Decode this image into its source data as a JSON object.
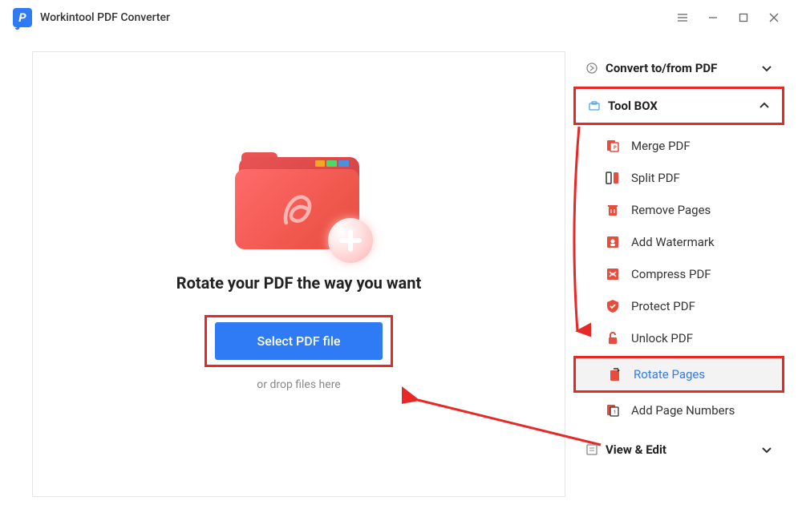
{
  "app": {
    "title": "Workintool PDF Converter"
  },
  "main": {
    "heading": "Rotate your PDF the way you want",
    "select_button": "Select PDF file",
    "drop_hint": "or drop files here"
  },
  "sidebar": {
    "sections": {
      "convert": {
        "label": "Convert to/from PDF"
      },
      "toolbox": {
        "label": "Tool BOX"
      },
      "view_edit": {
        "label": "View & Edit"
      }
    },
    "tools": [
      {
        "label": "Merge PDF"
      },
      {
        "label": "Split PDF"
      },
      {
        "label": "Remove Pages"
      },
      {
        "label": "Add Watermark"
      },
      {
        "label": "Compress PDF"
      },
      {
        "label": "Protect PDF"
      },
      {
        "label": "Unlock PDF"
      },
      {
        "label": "Rotate Pages"
      },
      {
        "label": "Add Page Numbers"
      }
    ]
  }
}
